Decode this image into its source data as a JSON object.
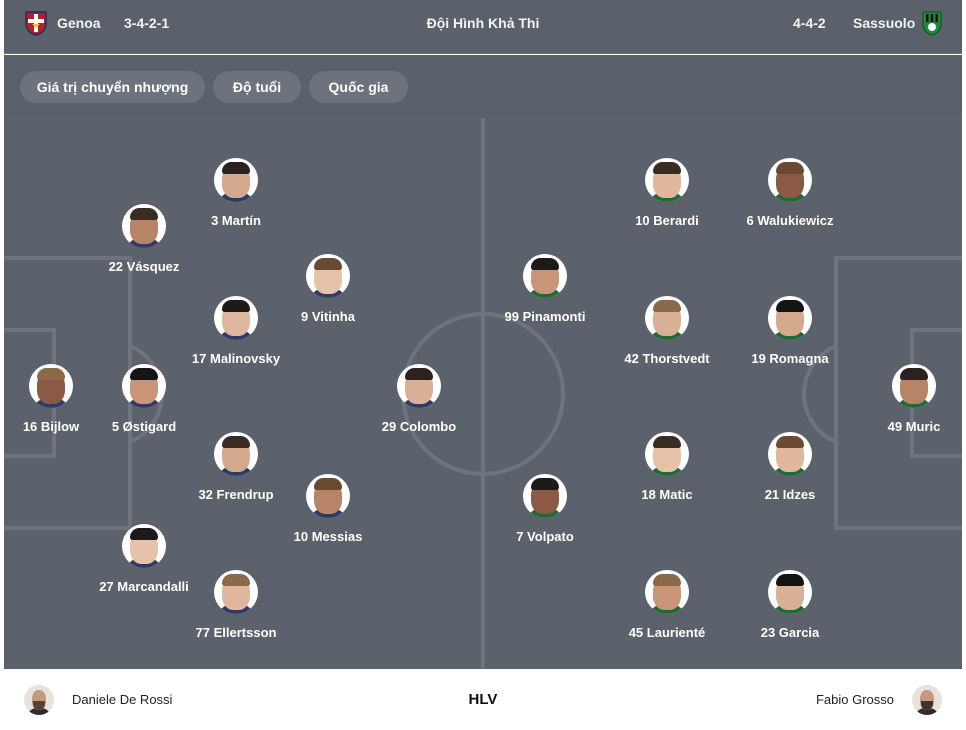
{
  "header": {
    "home_team": "Genoa",
    "home_formation": "3-4-2-1",
    "title": "Đội Hình Khả Thi",
    "away_formation": "4-4-2",
    "away_team": "Sassuolo",
    "home_crest_icon": "genoa-crest-icon",
    "away_crest_icon": "sassuolo-crest-icon"
  },
  "tabs": [
    {
      "label": "Giá trị chuyển nhượng"
    },
    {
      "label": "Độ tuổi"
    },
    {
      "label": "Quốc gia"
    }
  ],
  "colors": {
    "pitch": "#5b626c",
    "header": "#5a616b",
    "chip": "#6c737d",
    "text": "#ffffff"
  },
  "home_players": [
    {
      "label": "3 Martín"
    },
    {
      "label": "22 Vásquez"
    },
    {
      "label": "9 Vitinha"
    },
    {
      "label": "17 Malinovsky"
    },
    {
      "label": "16 Bijlow"
    },
    {
      "label": "5 Østigard"
    },
    {
      "label": "29 Colombo"
    },
    {
      "label": "32 Frendrup"
    },
    {
      "label": "10 Messias"
    },
    {
      "label": "27 Marcandalli"
    },
    {
      "label": "77 Ellertsson"
    }
  ],
  "away_players": [
    {
      "label": "10 Berardi"
    },
    {
      "label": "6 Walukiewicz"
    },
    {
      "label": "99 Pinamonti"
    },
    {
      "label": "42 Thorstvedt"
    },
    {
      "label": "19 Romagna"
    },
    {
      "label": "49 Muric"
    },
    {
      "label": "18 Matic"
    },
    {
      "label": "21 Idzes"
    },
    {
      "label": "7 Volpato"
    },
    {
      "label": "45 Laurienté"
    },
    {
      "label": "23 Garcia"
    }
  ],
  "coaches": {
    "home": "Daniele De Rossi",
    "label": "HLV",
    "away": "Fabio Grosso"
  }
}
